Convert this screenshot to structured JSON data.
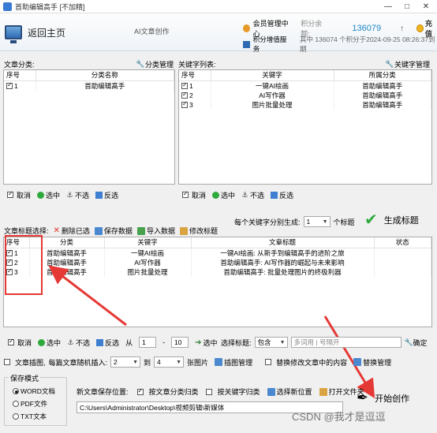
{
  "window": {
    "title": "首助编辑高手 [不加精]",
    "controls": [
      "—",
      "□",
      "✕"
    ]
  },
  "header": {
    "home_label": "返回主页",
    "subtitle": "AI文章创作",
    "member_center": "会员管理中心",
    "points_label": "积分余额:",
    "points_value": "136079",
    "up_arrow": "↑",
    "recharge": "充值",
    "points_service": "积分增值服务",
    "points_detail": "其中 136074 个积分于2024-09-25 08:26:37到期"
  },
  "category_panel": {
    "label": "文章分类:",
    "manage": "分类管理",
    "columns": [
      "序号",
      "分类名称"
    ],
    "rows": [
      {
        "checked": true,
        "no": "1",
        "name": "首助编辑高手"
      }
    ],
    "actions": {
      "cancel": "取消",
      "select": "选中",
      "unselect": "不选",
      "invert": "反选"
    }
  },
  "keyword_panel": {
    "label": "关键字列表:",
    "manage": "关键字管理",
    "columns": [
      "序号",
      "关键字",
      "所属分类"
    ],
    "rows": [
      {
        "checked": true,
        "no": "1",
        "keyword": "一键AI绘画",
        "category": "首助编辑高手"
      },
      {
        "checked": true,
        "no": "2",
        "keyword": "AI写作器",
        "category": "首助编辑高手"
      },
      {
        "checked": true,
        "no": "3",
        "keyword": "图片批量处理",
        "category": "首助编辑高手"
      }
    ],
    "actions": {
      "cancel": "取消",
      "select": "选中",
      "unselect": "不选",
      "invert": "反选"
    }
  },
  "title_toolbar": {
    "label": "文章标题选择:",
    "delete": "删除已选",
    "save": "保存数据",
    "import": "导入数据",
    "edit": "修改标题",
    "per_keyword_prefix": "每个关键字分别生成:",
    "per_keyword_value": "1",
    "per_keyword_suffix": "个标题",
    "generate": "生成标题"
  },
  "title_panel": {
    "columns": [
      "序号",
      "分类",
      "关键字",
      "文章标题",
      "状态"
    ],
    "rows": [
      {
        "checked": true,
        "no": "1",
        "category": "首助编辑高手",
        "keyword": "一键AI绘画",
        "title": "一键AI绘画: 从新手到编辑高手的进阶之旅",
        "status": ""
      },
      {
        "checked": true,
        "no": "2",
        "category": "首助编辑高手",
        "keyword": "AI写作器",
        "title": "首助编辑高手: AI写作器的崛起与未来影响",
        "status": ""
      },
      {
        "checked": true,
        "no": "3",
        "category": "首助编辑高手",
        "keyword": "图片批量处理",
        "title": "首助编辑高手: 批量处理图片的终极利器",
        "status": ""
      }
    ],
    "actions": {
      "cancel": "取消",
      "select": "选中",
      "unselect": "不选",
      "invert": "反选",
      "from": "从",
      "range_from": "1",
      "range_to": "10",
      "range_select": "选中",
      "select_title": "选择标题:",
      "contains": "包含",
      "search_placeholder": "多词用 | 号隔开",
      "confirm": "确定"
    }
  },
  "options": {
    "insert_image": "文章插图,",
    "random_insert": "每篇文章随机插入:",
    "random_from": "2",
    "to": "到",
    "random_to": "4",
    "images_unit": "张图片",
    "image_manage": "插图管理",
    "replace_content": "替换修改文章中的内容",
    "replace_manage": "替换管理"
  },
  "save_mode": {
    "legend": "保存模式",
    "options": [
      {
        "label": "WORD文档",
        "selected": true
      },
      {
        "label": "PDF文件",
        "selected": false
      },
      {
        "label": "TXT文本",
        "selected": false
      }
    ]
  },
  "save_location": {
    "label": "新文章保存位置:",
    "by_category": "按文章分类归类",
    "by_keyword": "按关键字归类",
    "choose": "选择新位置",
    "open": "打开文件夹",
    "path": "C:\\Users\\Administrator\\Desktop\\视频剪辑\\新媒体"
  },
  "start": "开始创作",
  "watermark": "CSDN @我才是逗逗"
}
